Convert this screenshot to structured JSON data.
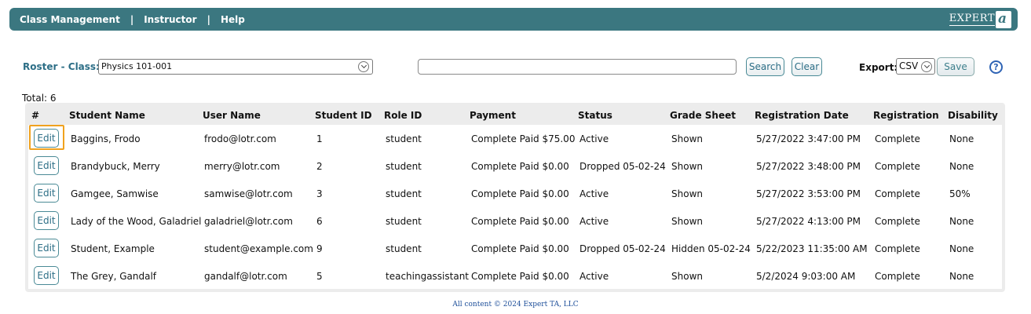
{
  "nav": {
    "items": [
      "Class Management",
      "Instructor",
      "Help"
    ],
    "separator": "|",
    "logo_text": "EXPERT",
    "logo_mark": "a"
  },
  "filter": {
    "roster_label": "Roster - Class:",
    "class_value": "Physics 101-001",
    "search_value": "",
    "search_label": "Search",
    "clear_label": "Clear",
    "export_label": "Export:",
    "export_value": "CSV",
    "save_label": "Save",
    "help_symbol": "?"
  },
  "total": "Total: 6",
  "table": {
    "columns": [
      "#",
      "Student Name",
      "User Name",
      "Student ID",
      "Role ID",
      "Payment",
      "Status",
      "Grade Sheet",
      "Registration Date",
      "Registration",
      "Disability"
    ],
    "edit_label": "Edit",
    "rows": [
      [
        "Baggins, Frodo",
        "frodo@lotr.com",
        "1",
        "student",
        "Complete Paid $75.00",
        "Active",
        "Shown",
        "5/27/2022 3:47:00 PM",
        "Complete",
        "None"
      ],
      [
        "Brandybuck, Merry",
        "merry@lotr.com",
        "2",
        "student",
        "Complete Paid $0.00",
        "Dropped 05-02-24",
        "Shown",
        "5/27/2022 3:48:00 PM",
        "Complete",
        "None"
      ],
      [
        "Gamgee, Samwise",
        "samwise@lotr.com",
        "3",
        "student",
        "Complete Paid $0.00",
        "Active",
        "Shown",
        "5/27/2022 3:53:00 PM",
        "Complete",
        "50%"
      ],
      [
        "Lady of the Wood, Galadriel",
        "galadriel@lotr.com",
        "6",
        "student",
        "Complete Paid $0.00",
        "Active",
        "Shown",
        "5/27/2022 4:13:00 PM",
        "Complete",
        "None"
      ],
      [
        "Student, Example",
        "student@example.com",
        "9",
        "student",
        "Complete Paid $0.00",
        "Dropped 05-02-24",
        "Hidden 05-02-24",
        "5/22/2023 11:35:00 AM",
        "Complete",
        "None"
      ],
      [
        "The Grey, Gandalf",
        "gandalf@lotr.com",
        "5",
        "teachingassistant",
        "Complete Paid $0.00",
        "Active",
        "Shown",
        "5/2/2024 9:03:00 AM",
        "Complete",
        "None"
      ]
    ]
  },
  "footer": "All content © 2024 Expert TA, LLC",
  "colors": {
    "topbar": "#3b7780",
    "accent_text": "#2c6e86",
    "focus_outline": "#f0a21e",
    "help_icon": "#2f64b5"
  }
}
